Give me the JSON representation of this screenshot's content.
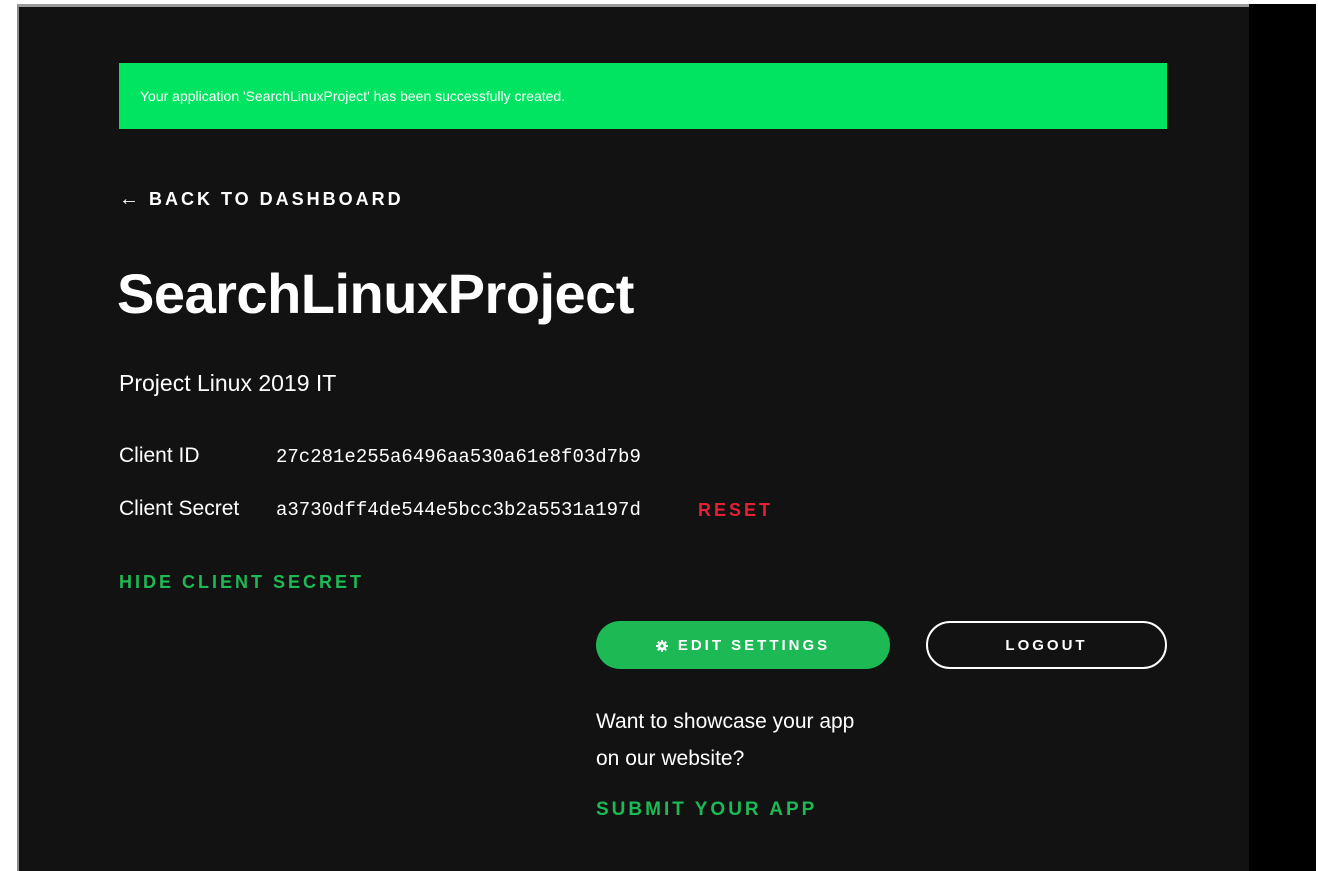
{
  "alert": {
    "message": "Your application 'SearchLinuxProject' has been successfully created."
  },
  "nav": {
    "back_arrow": "←",
    "back_label": "BACK TO DASHBOARD"
  },
  "app": {
    "name": "SearchLinuxProject",
    "description": "Project Linux 2019 IT"
  },
  "credentials": {
    "client_id_label": "Client ID",
    "client_id_value": "27c281e255a6496aa530a61e8f03d7b9",
    "client_secret_label": "Client Secret",
    "client_secret_value": "a3730dff4de544e5bcc3b2a5531a197d",
    "reset_label": "RESET",
    "hide_secret_label": "HIDE CLIENT SECRET"
  },
  "actions": {
    "edit_settings_label": "EDIT SETTINGS",
    "edit_settings_icon": "gear-icon",
    "logout_label": "LOGOUT"
  },
  "showcase": {
    "text": "Want to showcase your app on our website?",
    "submit_label": "SUBMIT YOUR APP"
  },
  "colors": {
    "background": "#121212",
    "alert_green": "#00e461",
    "brand_green": "#1db954",
    "reset_red": "#e22134",
    "text": "#ffffff"
  }
}
